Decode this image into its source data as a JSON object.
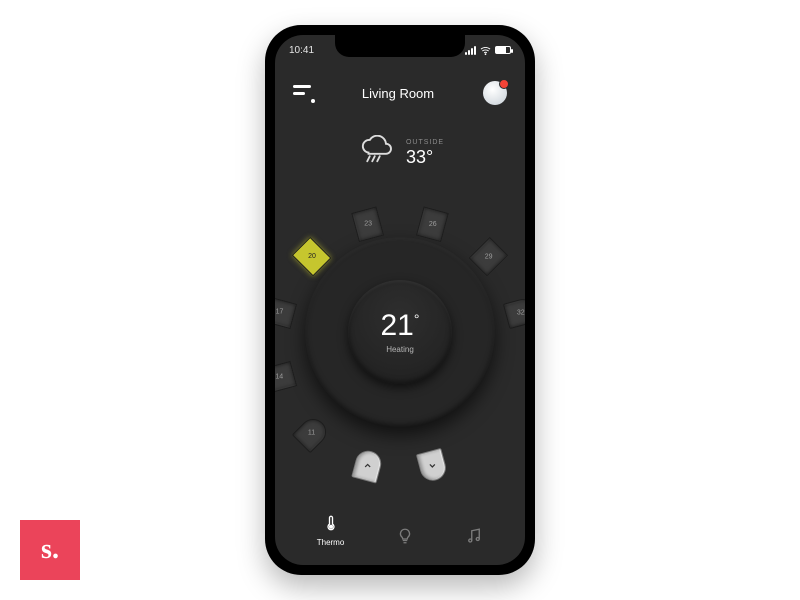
{
  "statusbar": {
    "time": "10:41"
  },
  "header": {
    "title": "Living Room"
  },
  "weather": {
    "label": "OUTSIDE",
    "outside_temp": "33°"
  },
  "thermostat": {
    "current_temp": "21",
    "status": "Heating",
    "target_segment": "20",
    "ring_numbers": [
      "11",
      "14",
      "17",
      "20",
      "23",
      "26",
      "29",
      "32"
    ]
  },
  "tabs": {
    "thermo": "Thermo",
    "light": "Light",
    "music": "Music"
  },
  "brand": {
    "text": "s."
  },
  "colors": {
    "bg_dark": "#2A2A2A",
    "accent_yellow": "#C6C62E",
    "brand_pink": "#EB445A",
    "notif_red": "#F44336"
  }
}
